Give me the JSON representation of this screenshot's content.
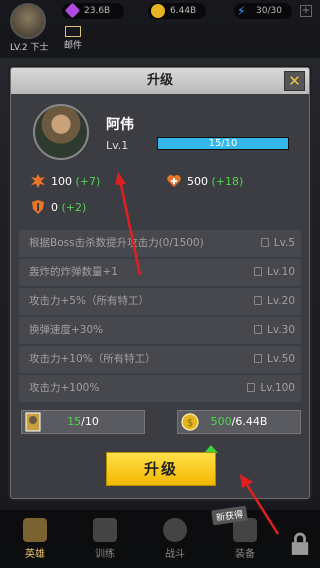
{
  "topbar": {
    "level_text": "LV.2 下士",
    "resources": [
      {
        "icon": "gem-icon",
        "value": "23.6B",
        "color": "#b04be0"
      },
      {
        "icon": "gold-coin-icon",
        "value": "6.44B",
        "color": "#e6b422"
      },
      {
        "icon": "energy-icon",
        "value": "30/30",
        "color": "#3aa0ff"
      }
    ],
    "mail_label": "邮件"
  },
  "modal": {
    "title": "升级",
    "close_symbol": "✕",
    "hero": {
      "name": "阿伟",
      "level": "Lv.1",
      "xp_text": "15/10",
      "xp_fraction": 1.0
    },
    "stats": [
      {
        "icon": "attack-icon",
        "value": "100",
        "bonus": "(+7)"
      },
      {
        "icon": "health-icon",
        "value": "500",
        "bonus": "(+18)"
      },
      {
        "icon": "armor-icon",
        "value": "0",
        "bonus": "(+2)"
      }
    ],
    "perks": [
      {
        "text": "根据Boss击杀数提升攻击力(0/1500)",
        "level": "Lv.5"
      },
      {
        "text": "轰炸的炸弹数量+1",
        "level": "Lv.10"
      },
      {
        "text": "攻击力+5%（所有特工）",
        "level": "Lv.20"
      },
      {
        "text": "换弹速度+30%",
        "level": "Lv.30"
      },
      {
        "text": "攻击力+10%（所有特工）",
        "level": "Lv.50"
      },
      {
        "text": "攻击力+100%",
        "level": "Lv.100"
      }
    ],
    "cost_cards": {
      "have": "15",
      "need": "/10"
    },
    "cost_gold": {
      "have": "500",
      "need": "/6.44B"
    },
    "upgrade_label": "升级"
  },
  "badge_new": "新获得",
  "bottom_nav": [
    {
      "label": "英雄",
      "icon": "hero-icon",
      "active": true
    },
    {
      "label": "训练",
      "icon": "training-icon",
      "active": false
    },
    {
      "label": "战斗",
      "icon": "battle-icon",
      "active": false
    },
    {
      "label": "装备",
      "icon": "equipment-icon",
      "active": false
    }
  ],
  "colors": {
    "accent_green": "#4fd64f",
    "xp_blue": "#33b6e8",
    "button_yellow": "#f2c400",
    "annotation_red": "#e02020"
  }
}
